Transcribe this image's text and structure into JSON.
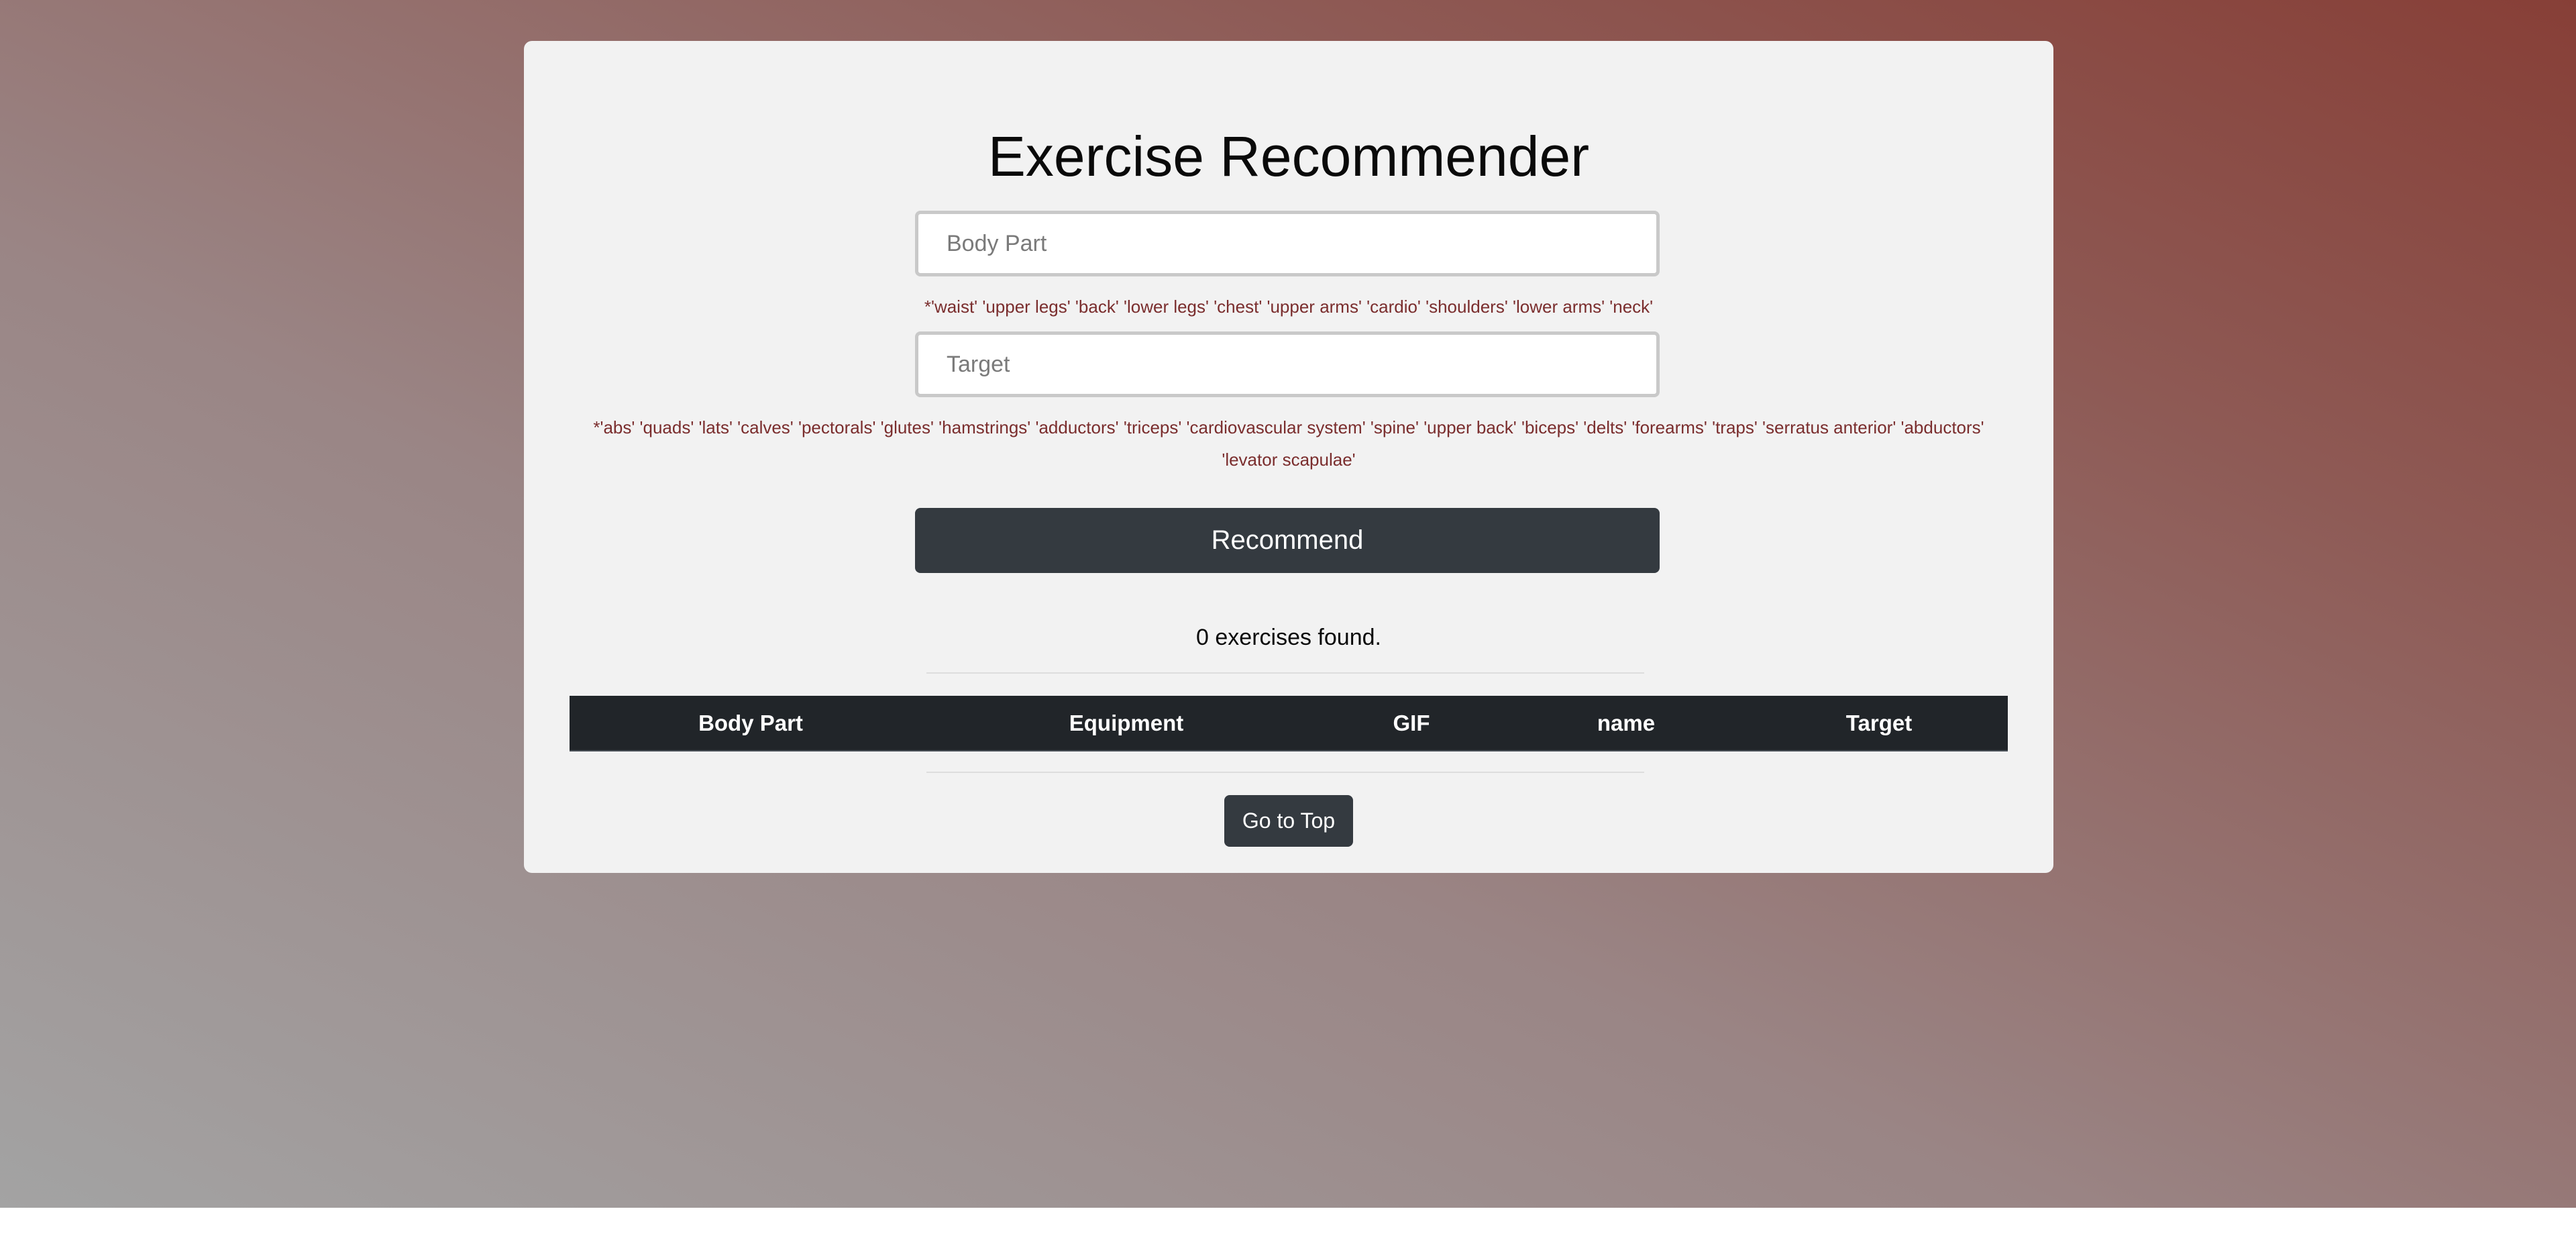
{
  "app": {
    "title": "Exercise Recommender"
  },
  "form": {
    "body_part": {
      "value": "",
      "placeholder": "Body Part",
      "hint": "*'waist' 'upper legs' 'back' 'lower legs' 'chest' 'upper arms' 'cardio' 'shoulders' 'lower arms' 'neck'"
    },
    "target": {
      "value": "",
      "placeholder": "Target",
      "hint": "*'abs' 'quads' 'lats' 'calves' 'pectorals' 'glutes' 'hamstrings' 'adductors' 'triceps' 'cardiovascular system' 'spine' 'upper back' 'biceps' 'delts' 'forearms' 'traps' 'serratus anterior' 'abductors' 'levator scapulae'"
    },
    "recommend_label": "Recommend"
  },
  "results": {
    "count_text": "0 exercises found.",
    "columns": [
      "Body Part",
      "Equipment",
      "GIF",
      "name",
      "Target"
    ],
    "rows": []
  },
  "footer": {
    "go_to_top_label": "Go to Top"
  },
  "colors": {
    "card_background": "#f2f2f2",
    "button_dark": "#343a40",
    "table_header": "#212529",
    "hint_text": "#7a2d2d"
  }
}
